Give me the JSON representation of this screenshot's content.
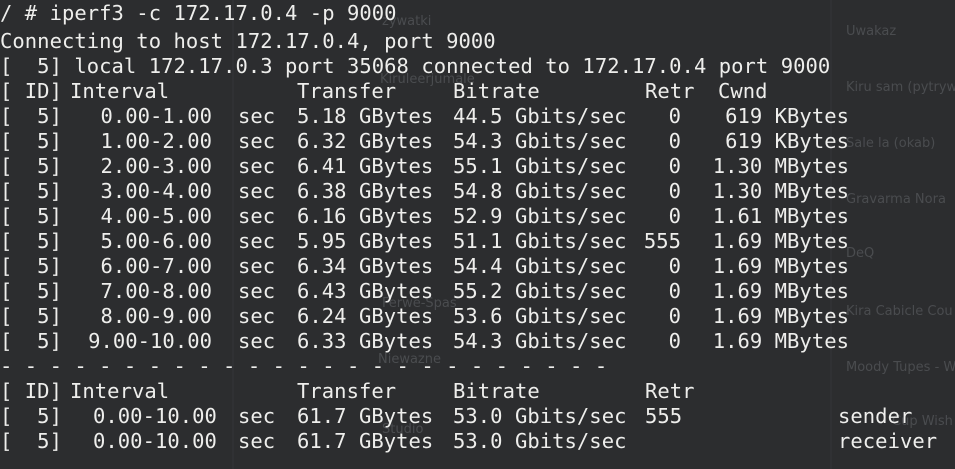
{
  "background": {
    "color": "#2c2d2f",
    "faded_text": [
      "zywatki",
      "Kiruleerjumale",
      "Ferwe-Spas",
      "Niewazne",
      "Studio",
      "Kiru sam (pytryw",
      "Sale la (okab)",
      "Gravarma Nora",
      "DeQ",
      "Kira Cabicle Cou",
      "Moody Tupes - Wi",
      "Cup Wish W",
      "Uwakaz"
    ]
  },
  "terminal": {
    "fg_color": "#eeeeec",
    "command": "/ # iperf3 -c 172.17.0.4 -p 9000",
    "connecting": "Connecting to host 172.17.0.4, port 9000",
    "local_line": "[  5] local 172.17.0.3 port 35068 connected to 172.17.0.4 port 9000",
    "header": {
      "id": "[ ID]",
      "interval": "Interval",
      "transfer": "Transfer",
      "bitrate": "Bitrate",
      "retr": "Retr",
      "cwnd": "Cwnd"
    },
    "rows": [
      {
        "id": "[  5]",
        "interval": "0.00-1.00",
        "unit": "sec",
        "transfer": "5.18 GBytes",
        "bitrate": "44.5 Gbits/sec",
        "retr": "0",
        "cwnd": "619 KBytes"
      },
      {
        "id": "[  5]",
        "interval": "1.00-2.00",
        "unit": "sec",
        "transfer": "6.32 GBytes",
        "bitrate": "54.3 Gbits/sec",
        "retr": "0",
        "cwnd": "619 KBytes"
      },
      {
        "id": "[  5]",
        "interval": "2.00-3.00",
        "unit": "sec",
        "transfer": "6.41 GBytes",
        "bitrate": "55.1 Gbits/sec",
        "retr": "0",
        "cwnd": "1.30 MBytes"
      },
      {
        "id": "[  5]",
        "interval": "3.00-4.00",
        "unit": "sec",
        "transfer": "6.38 GBytes",
        "bitrate": "54.8 Gbits/sec",
        "retr": "0",
        "cwnd": "1.30 MBytes"
      },
      {
        "id": "[  5]",
        "interval": "4.00-5.00",
        "unit": "sec",
        "transfer": "6.16 GBytes",
        "bitrate": "52.9 Gbits/sec",
        "retr": "0",
        "cwnd": "1.61 MBytes"
      },
      {
        "id": "[  5]",
        "interval": "5.00-6.00",
        "unit": "sec",
        "transfer": "5.95 GBytes",
        "bitrate": "51.1 Gbits/sec",
        "retr": "555",
        "cwnd": "1.69 MBytes"
      },
      {
        "id": "[  5]",
        "interval": "6.00-7.00",
        "unit": "sec",
        "transfer": "6.34 GBytes",
        "bitrate": "54.4 Gbits/sec",
        "retr": "0",
        "cwnd": "1.69 MBytes"
      },
      {
        "id": "[  5]",
        "interval": "7.00-8.00",
        "unit": "sec",
        "transfer": "6.43 GBytes",
        "bitrate": "55.2 Gbits/sec",
        "retr": "0",
        "cwnd": "1.69 MBytes"
      },
      {
        "id": "[  5]",
        "interval": "8.00-9.00",
        "unit": "sec",
        "transfer": "6.24 GBytes",
        "bitrate": "53.6 Gbits/sec",
        "retr": "0",
        "cwnd": "1.69 MBytes"
      },
      {
        "id": "[  5]",
        "interval": "9.00-10.00",
        "unit": "sec",
        "transfer": "6.33 GBytes",
        "bitrate": "54.3 Gbits/sec",
        "retr": "0",
        "cwnd": "1.69 MBytes"
      }
    ],
    "separator": "- - - - - - - - - - - - - - - - - - - - - - - - -",
    "summary_header": {
      "id": "[ ID]",
      "interval": "Interval",
      "transfer": "Transfer",
      "bitrate": "Bitrate",
      "retr": "Retr"
    },
    "summary_rows": [
      {
        "id": "[  5]",
        "interval": "0.00-10.00",
        "unit": "sec",
        "transfer": "61.7 GBytes",
        "bitrate": "53.0 Gbits/sec",
        "retr": "555",
        "role": "sender"
      },
      {
        "id": "[  5]",
        "interval": "0.00-10.00",
        "unit": "sec",
        "transfer": "61.7 GBytes",
        "bitrate": "53.0 Gbits/sec",
        "retr": "",
        "role": "receiver"
      }
    ]
  }
}
